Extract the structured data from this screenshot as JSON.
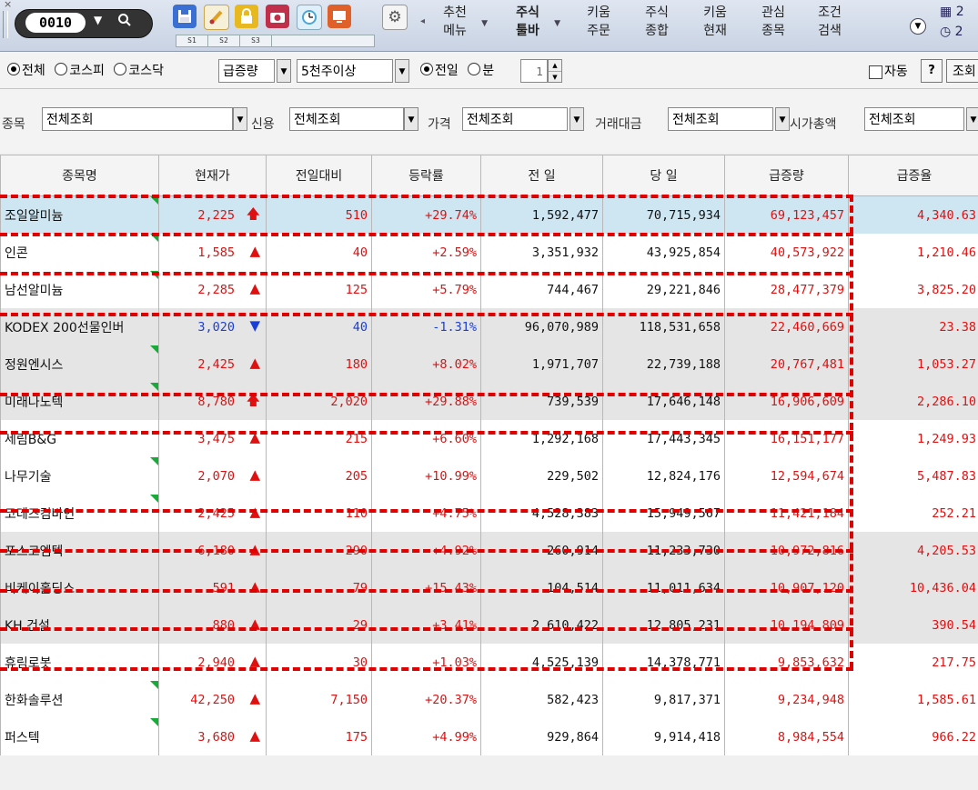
{
  "toolbar": {
    "code": "0010",
    "screen_tabs": [
      "S1",
      "S2",
      "S3"
    ],
    "menus": [
      {
        "line1": "추천",
        "line2": "메뉴",
        "dropdown": true,
        "bold": false
      },
      {
        "line1": "주식",
        "line2": "툴바",
        "dropdown": true,
        "bold": true
      },
      {
        "line1": "키움",
        "line2": "주문",
        "dropdown": false,
        "bold": false
      },
      {
        "line1": "주식",
        "line2": "종합",
        "dropdown": false,
        "bold": false
      },
      {
        "line1": "키움",
        "line2": "현재",
        "dropdown": false,
        "bold": false
      },
      {
        "line1": "관심",
        "line2": "종목",
        "dropdown": false,
        "bold": false
      },
      {
        "line1": "조건",
        "line2": "검색",
        "dropdown": false,
        "bold": false
      }
    ],
    "date_fragment_1": "2",
    "date_fragment_2": "2",
    "icons": [
      "save-icon",
      "brush-icon",
      "lock-icon",
      "camera-icon",
      "clock-icon",
      "monitor-icon",
      "gear-icon"
    ],
    "colors": {
      "save": "#3b6fd1",
      "brush": "#f0a020",
      "lock": "#e8b820",
      "camera": "#c0304a",
      "clock": "#4aa6d8",
      "monitor": "#e0602a",
      "gear": "#6b6b6b"
    }
  },
  "filters": {
    "market_options": [
      "전체",
      "코스피",
      "코스닥"
    ],
    "market_selected": "전체",
    "sort_by": "급증량",
    "volume_filter": "5천주이상",
    "period_options": [
      "전일",
      "분"
    ],
    "period_selected": "전일",
    "minute_value": "1",
    "auto_label": "자동",
    "help_label": "?",
    "query_label": "조회",
    "row2": [
      {
        "label": "종목",
        "value": "전체조회"
      },
      {
        "label": "신용",
        "value": "전체조회"
      },
      {
        "label": "가격",
        "value": "전체조회"
      },
      {
        "label": "거래대금",
        "value": "전체조회"
      },
      {
        "label": "시가총액",
        "value": "전체조회"
      }
    ]
  },
  "table": {
    "columns": [
      "종목명",
      "현재가",
      "전일대비",
      "등락률",
      "전 일",
      "당 일",
      "급증량",
      "급증율"
    ],
    "rows": [
      {
        "name": "조일알미늄",
        "price": "2,225",
        "dir": "limit-up",
        "change": "510",
        "rate": "+29.74%",
        "prev": "1,592,477",
        "today": "70,715,934",
        "surge": "69,123,457",
        "surge_rate": "4,340.63",
        "bg": "b",
        "flag": true
      },
      {
        "name": "인콘",
        "price": "1,585",
        "dir": "up",
        "change": "40",
        "rate": "+2.59%",
        "prev": "3,351,932",
        "today": "43,925,854",
        "surge": "40,573,922",
        "surge_rate": "1,210.46",
        "bg": "w",
        "flag": true
      },
      {
        "name": "남선알미늄",
        "price": "2,285",
        "dir": "up",
        "change": "125",
        "rate": "+5.79%",
        "prev": "744,467",
        "today": "29,221,846",
        "surge": "28,477,379",
        "surge_rate": "3,825.20",
        "bg": "w",
        "flag": true
      },
      {
        "name": "KODEX 200선물인버",
        "price": "3,020",
        "dir": "down",
        "change": "40",
        "rate": "-1.31%",
        "prev": "96,070,989",
        "today": "118,531,658",
        "surge": "22,460,669",
        "surge_rate": "23.38",
        "bg": "g",
        "flag": false
      },
      {
        "name": "정원엔시스",
        "price": "2,425",
        "dir": "up",
        "change": "180",
        "rate": "+8.02%",
        "prev": "1,971,707",
        "today": "22,739,188",
        "surge": "20,767,481",
        "surge_rate": "1,053.27",
        "bg": "g",
        "flag": true
      },
      {
        "name": "미래나노텍",
        "price": "8,780",
        "dir": "limit-up",
        "change": "2,020",
        "rate": "+29.88%",
        "prev": "739,539",
        "today": "17,646,148",
        "surge": "16,906,609",
        "surge_rate": "2,286.10",
        "bg": "g",
        "flag": true
      },
      {
        "name": "세림B&G",
        "price": "3,475",
        "dir": "up",
        "change": "215",
        "rate": "+6.60%",
        "prev": "1,292,168",
        "today": "17,443,345",
        "surge": "16,151,177",
        "surge_rate": "1,249.93",
        "bg": "w",
        "flag": false
      },
      {
        "name": "나무기술",
        "price": "2,070",
        "dir": "up",
        "change": "205",
        "rate": "+10.99%",
        "prev": "229,502",
        "today": "12,824,176",
        "surge": "12,594,674",
        "surge_rate": "5,487.83",
        "bg": "w",
        "flag": true
      },
      {
        "name": "코데즈컴바인",
        "price": "2,425",
        "dir": "up",
        "change": "110",
        "rate": "+4.75%",
        "prev": "4,528,383",
        "today": "15,949,567",
        "surge": "11,421,184",
        "surge_rate": "252.21",
        "bg": "w",
        "flag": true
      },
      {
        "name": "포스코엠텍",
        "price": "6,180",
        "dir": "up",
        "change": "290",
        "rate": "+4.92%",
        "prev": "260,914",
        "today": "11,233,730",
        "surge": "10,972,816",
        "surge_rate": "4,205.53",
        "bg": "g",
        "flag": false
      },
      {
        "name": "비케이홀딩스",
        "price": "591",
        "dir": "up",
        "change": "79",
        "rate": "+15.43%",
        "prev": "104,514",
        "today": "11,011,634",
        "surge": "10,907,120",
        "surge_rate": "10,436.04",
        "bg": "g",
        "flag": false
      },
      {
        "name": "KH 건설",
        "price": "880",
        "dir": "up",
        "change": "29",
        "rate": "+3.41%",
        "prev": "2,610,422",
        "today": "12,805,231",
        "surge": "10,194,809",
        "surge_rate": "390.54",
        "bg": "g",
        "flag": false
      },
      {
        "name": "휴림로봇",
        "price": "2,940",
        "dir": "up",
        "change": "30",
        "rate": "+1.03%",
        "prev": "4,525,139",
        "today": "14,378,771",
        "surge": "9,853,632",
        "surge_rate": "217.75",
        "bg": "w",
        "flag": false
      },
      {
        "name": "한화솔루션",
        "price": "42,250",
        "dir": "up",
        "change": "7,150",
        "rate": "+20.37%",
        "prev": "582,423",
        "today": "9,817,371",
        "surge": "9,234,948",
        "surge_rate": "1,585.61",
        "bg": "w",
        "flag": true
      },
      {
        "name": "퍼스텍",
        "price": "3,680",
        "dir": "up",
        "change": "175",
        "rate": "+4.99%",
        "prev": "929,864",
        "today": "9,914,418",
        "surge": "8,984,554",
        "surge_rate": "966.22",
        "bg": "w",
        "flag": true
      }
    ]
  },
  "colors": {
    "up": "#e01010",
    "down": "#1a3ed6",
    "highlight_row": "#cde6f2",
    "shaded_row": "#e5e5e5",
    "annotation": "#e00000"
  }
}
